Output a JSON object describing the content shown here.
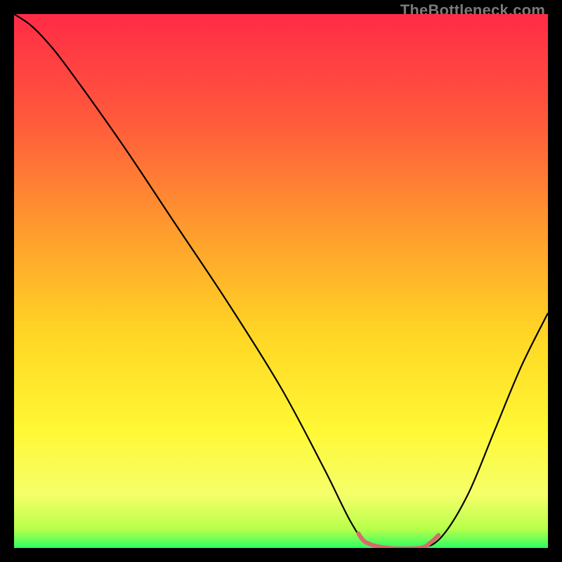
{
  "watermark": "TheBottleneck.com",
  "chart_data": {
    "type": "line",
    "title": "",
    "xlabel": "",
    "ylabel": "",
    "xlim": [
      0,
      100
    ],
    "ylim": [
      0,
      100
    ],
    "grid": false,
    "background_gradient": {
      "stops": [
        {
          "offset": 0.0,
          "color": "#ff2b46"
        },
        {
          "offset": 0.2,
          "color": "#ff5a3c"
        },
        {
          "offset": 0.4,
          "color": "#ff9a2e"
        },
        {
          "offset": 0.6,
          "color": "#ffd624"
        },
        {
          "offset": 0.78,
          "color": "#fff835"
        },
        {
          "offset": 0.9,
          "color": "#f5ff6a"
        },
        {
          "offset": 0.965,
          "color": "#b7ff4a"
        },
        {
          "offset": 1.0,
          "color": "#2dff62"
        }
      ]
    },
    "series": [
      {
        "name": "bottleneck-curve",
        "color": "#000000",
        "width": 2.2,
        "points": [
          {
            "x": 0,
            "y": 100
          },
          {
            "x": 3,
            "y": 98
          },
          {
            "x": 6,
            "y": 95
          },
          {
            "x": 10,
            "y": 90
          },
          {
            "x": 20,
            "y": 76
          },
          {
            "x": 30,
            "y": 61
          },
          {
            "x": 40,
            "y": 46
          },
          {
            "x": 50,
            "y": 30
          },
          {
            "x": 58,
            "y": 15
          },
          {
            "x": 63,
            "y": 5
          },
          {
            "x": 66,
            "y": 1
          },
          {
            "x": 70,
            "y": 0
          },
          {
            "x": 76,
            "y": 0
          },
          {
            "x": 80,
            "y": 2
          },
          {
            "x": 85,
            "y": 10
          },
          {
            "x": 90,
            "y": 22
          },
          {
            "x": 95,
            "y": 34
          },
          {
            "x": 100,
            "y": 44
          }
        ]
      }
    ],
    "highlight": {
      "name": "optimal-range",
      "color": "#d86a6a",
      "width": 6,
      "points": [
        {
          "x": 64.5,
          "y": 2.7
        },
        {
          "x": 66,
          "y": 1
        },
        {
          "x": 70,
          "y": 0
        },
        {
          "x": 76,
          "y": 0
        },
        {
          "x": 78,
          "y": 1
        },
        {
          "x": 79.5,
          "y": 2.4
        }
      ]
    }
  }
}
